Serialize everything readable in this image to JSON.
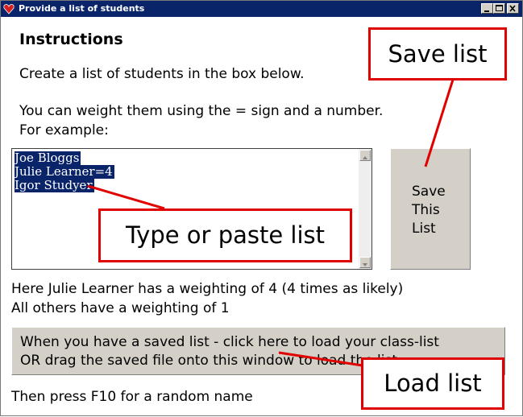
{
  "window": {
    "title": "Provide a list of students",
    "controls": [
      "minimize",
      "maximize",
      "close"
    ]
  },
  "instructions": {
    "heading": "Instructions",
    "line1": "Create a list of students in the box below.",
    "line2": "You can weight them using the = sign and a number.",
    "line3": "For example:"
  },
  "student_list": {
    "lines": [
      "Joe Bloggs",
      "Julie Learner=4",
      "Igor Studyer"
    ]
  },
  "save_button": {
    "line1": "Save",
    "line2": "This",
    "line3": "List"
  },
  "weighting_note": {
    "line1": "Here Julie Learner has a weighting of 4 (4 times as likely)",
    "line2": "All others have a weighting of 1"
  },
  "load_button": {
    "line1": "When you have a saved list - click here to load your class-list",
    "line2": "OR drag the saved file onto this window to load the list"
  },
  "footer": {
    "text": "Then press F10 for a random name"
  },
  "callouts": {
    "save": "Save list",
    "type": "Type or paste list",
    "load": "Load list"
  },
  "colors": {
    "titlebar": "#0a246a",
    "selection": "#0a246a",
    "callout_border": "#e00000",
    "button_face": "#d4d0c8"
  }
}
